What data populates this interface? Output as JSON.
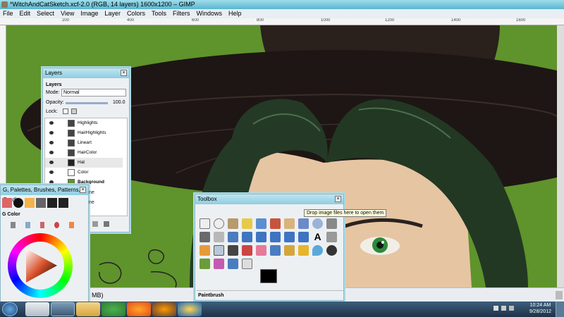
{
  "window": {
    "title": "*WitchAndCatSketch.xcf-2.0 (RGB, 14 layers) 1600x1200 – GIMP"
  },
  "menu": [
    "File",
    "Edit",
    "Select",
    "View",
    "Image",
    "Layer",
    "Colors",
    "Tools",
    "Filters",
    "Windows",
    "Help"
  ],
  "ruler": {
    "ticks": [
      "200",
      "400",
      "600",
      "800",
      "1000",
      "1200",
      "1400",
      "1600"
    ]
  },
  "layers_panel": {
    "title": "Layers",
    "tab_label": "Layers",
    "mode_label": "Mode:",
    "mode_value": "Normal",
    "opacity_label": "Opacity:",
    "opacity_value": "100.0",
    "lock_label": "Lock:",
    "layers": [
      "Highlights",
      "HairHighlights",
      "Lineart",
      "HairColor",
      "Hat",
      "Color",
      "Background"
    ]
  },
  "brushes_panel": {
    "title": "G, Palettes, Brushes, Patterns, Gradi...",
    "color_label": "G Color",
    "partial_labels": [
      "ne",
      "ne"
    ]
  },
  "toolbox": {
    "title": "Toolbox",
    "tooltip": "Drop image files here to open them",
    "active_tool_label": "Paintbrush"
  },
  "status": {
    "partial_text": "MB)"
  },
  "taskbar": {
    "time": "10:24 AM",
    "date": "9/28/2012"
  }
}
